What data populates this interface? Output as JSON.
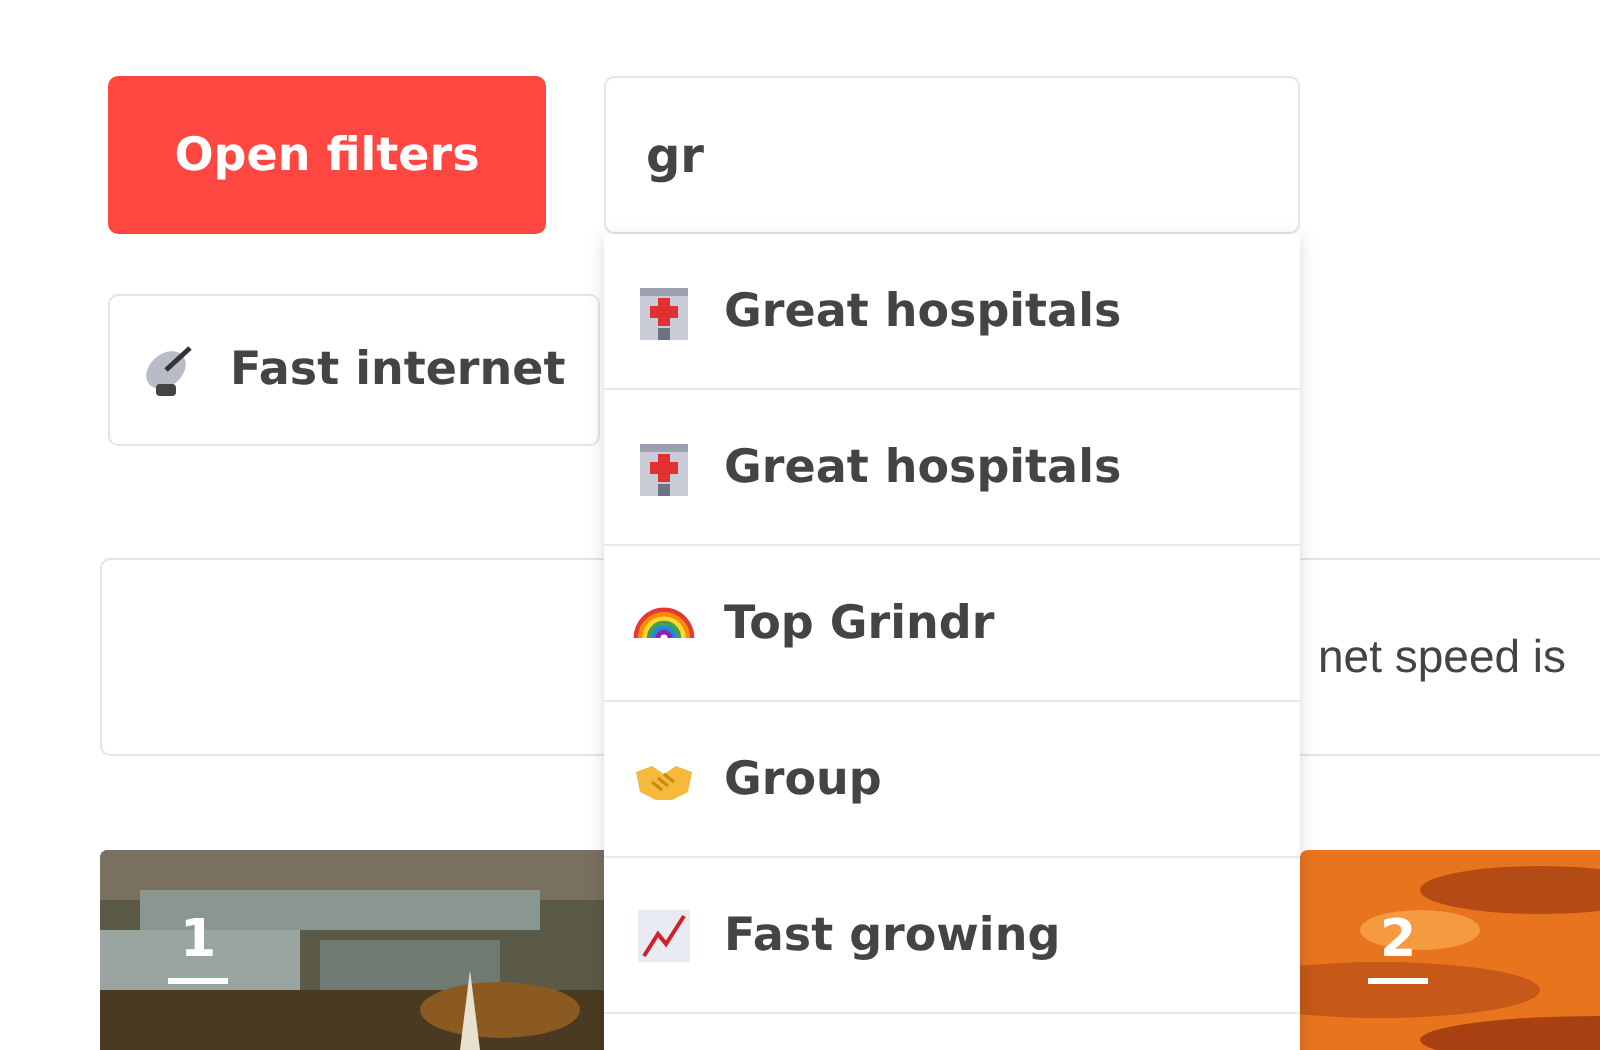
{
  "filter_button": "Open filters",
  "search": {
    "value": "gr"
  },
  "chips": [
    {
      "label": "Fast internet"
    }
  ],
  "info_box": {
    "text": "net speed is"
  },
  "dropdown": {
    "items": [
      {
        "label": "Great hospitals"
      },
      {
        "label": "Great hospitals"
      },
      {
        "label": "Top Grindr"
      },
      {
        "label": "Group"
      },
      {
        "label": "Fast growing"
      }
    ]
  },
  "cards": [
    {
      "number": "1",
      "kind": "picture"
    },
    {
      "number": "2",
      "kind": "picture"
    }
  ]
}
